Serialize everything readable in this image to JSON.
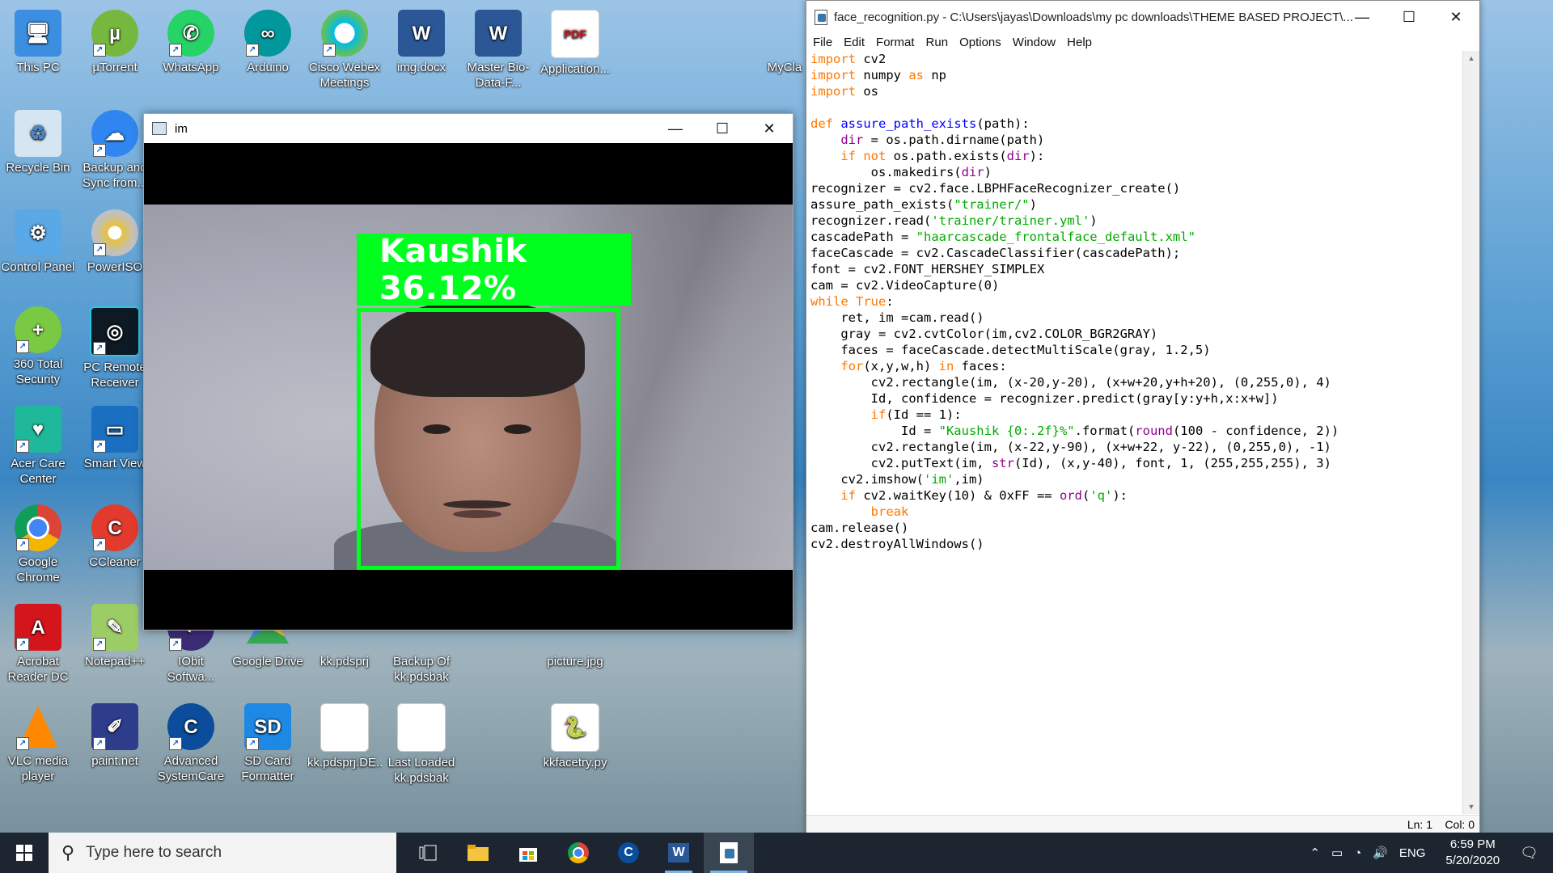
{
  "desktop": {
    "icons": [
      {
        "label": "This PC"
      },
      {
        "label": "µTorrent"
      },
      {
        "label": "WhatsApp"
      },
      {
        "label": "Arduino"
      },
      {
        "label": "Cisco Webex Meetings"
      },
      {
        "label": "img.docx"
      },
      {
        "label": "Master Bio-Data-F..."
      },
      {
        "label": "Application..."
      },
      {
        "label": "MyCla"
      },
      {
        "label": "Recycle Bin"
      },
      {
        "label": "Backup and Sync from..."
      },
      {
        "label": "Control Panel"
      },
      {
        "label": "PowerISO"
      },
      {
        "label": "360 Total Security"
      },
      {
        "label": "PC Remote Receiver"
      },
      {
        "label": "Acer Care Center"
      },
      {
        "label": "Smart View"
      },
      {
        "label": "Google Chrome"
      },
      {
        "label": "CCleaner"
      },
      {
        "label": "Acrobat Reader DC"
      },
      {
        "label": "Notepad++"
      },
      {
        "label": "IObit Softwa..."
      },
      {
        "label": "Google Drive"
      },
      {
        "label": "kk.pdsprj"
      },
      {
        "label": "Backup Of kk.pdsbak"
      },
      {
        "label": "picture.jpg"
      },
      {
        "label": "VLC media player"
      },
      {
        "label": "paint.net"
      },
      {
        "label": "Advanced SystemCare"
      },
      {
        "label": "SD Card Formatter"
      },
      {
        "label": "kk.pdsprj.DE..."
      },
      {
        "label": "Last Loaded kk.pdsbak"
      },
      {
        "label": "kkfacetry.py"
      }
    ]
  },
  "im_window": {
    "title": "im",
    "overlay_label": "Kaushik 36.12%"
  },
  "idle_window": {
    "title": "face_recognition.py - C:\\Users\\jayas\\Downloads\\my pc downloads\\THEME BASED PROJECT\\...",
    "menu": [
      "File",
      "Edit",
      "Format",
      "Run",
      "Options",
      "Window",
      "Help"
    ],
    "code_lines": [
      "import cv2",
      "import numpy as np",
      "import os",
      "",
      "def assure_path_exists(path):",
      "    dir = os.path.dirname(path)",
      "    if not os.path.exists(dir):",
      "        os.makedirs(dir)",
      "recognizer = cv2.face.LBPHFaceRecognizer_create()",
      "assure_path_exists(\"trainer/\")",
      "recognizer.read('trainer/trainer.yml')",
      "cascadePath = \"haarcascade_frontalface_default.xml\"",
      "faceCascade = cv2.CascadeClassifier(cascadePath);",
      "font = cv2.FONT_HERSHEY_SIMPLEX",
      "cam = cv2.VideoCapture(0)",
      "while True:",
      "    ret, im =cam.read()",
      "    gray = cv2.cvtColor(im,cv2.COLOR_BGR2GRAY)",
      "    faces = faceCascade.detectMultiScale(gray, 1.2,5)",
      "    for(x,y,w,h) in faces:",
      "        cv2.rectangle(im, (x-20,y-20), (x+w+20,y+h+20), (0,255,0), 4)",
      "        Id, confidence = recognizer.predict(gray[y:y+h,x:x+w])",
      "        if(Id == 1):",
      "            Id = \"Kaushik {0:.2f}%\".format(round(100 - confidence, 2))",
      "        cv2.rectangle(im, (x-22,y-90), (x+w+22, y-22), (0,255,0), -1)",
      "        cv2.putText(im, str(Id), (x,y-40), font, 1, (255,255,255), 3)",
      "    cv2.imshow('im',im)",
      "    if cv2.waitKey(10) & 0xFF == ord('q'):",
      "        break",
      "cam.release()",
      "cv2.destroyAllWindows()"
    ],
    "status": {
      "ln": "Ln: 1",
      "col": "Col: 0"
    }
  },
  "taskbar": {
    "search_placeholder": "Type here to search",
    "apps": [
      "task-view",
      "file-explorer",
      "microsoft-store",
      "google-chrome",
      "advanced-systemcare",
      "microsoft-word",
      "python-idle"
    ],
    "language": "ENG",
    "time": "6:59 PM",
    "date": "5/20/2020"
  },
  "colors": {
    "face_box": "#00ff1e",
    "taskbar": "#1c2530"
  }
}
